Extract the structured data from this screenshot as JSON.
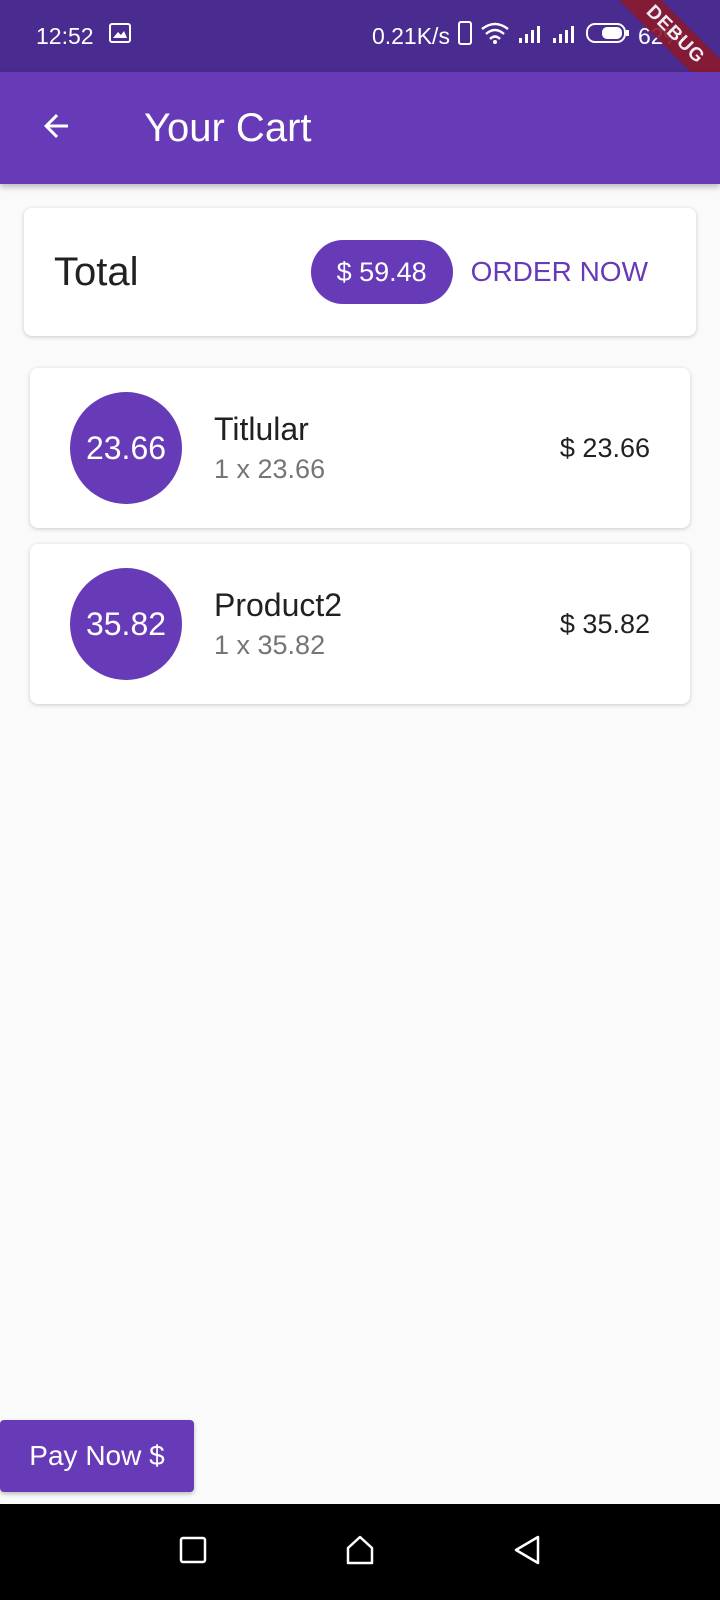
{
  "status_bar": {
    "time": "12:52",
    "net_speed": "0.21K/s",
    "battery": "62%",
    "debug_label": "DEBUG"
  },
  "app_bar": {
    "title": "Your Cart",
    "back_icon": "arrow-back-icon"
  },
  "summary": {
    "label": "Total",
    "amount": "$ 59.48",
    "order_label": "ORDER NOW"
  },
  "items": [
    {
      "avatar": "23.66",
      "title": "Titlular",
      "subtitle": "1 x 23.66",
      "price": "$ 23.66"
    },
    {
      "avatar": "35.82",
      "title": "Product2",
      "subtitle": "1 x 35.82",
      "price": "$ 35.82"
    }
  ],
  "pay_button": {
    "label": "Pay Now $"
  },
  "nav_bar": {
    "icons": [
      "recents-square-icon",
      "home-icon",
      "back-triangle-icon"
    ]
  },
  "colors": {
    "primary": "#673ab7",
    "status_bar": "#4a2b8f",
    "background": "#fafafa"
  }
}
